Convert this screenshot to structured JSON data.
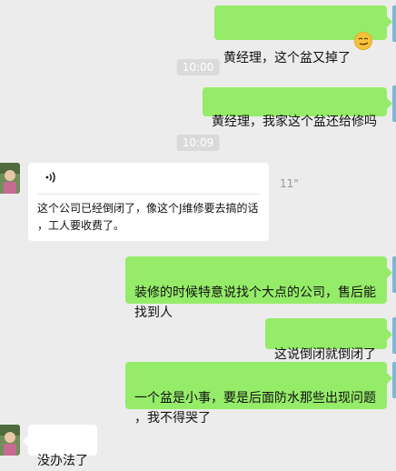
{
  "chat": {
    "messages": [
      {
        "text": "黄经理，这个盆又掉了",
        "emoji": "smirking-face-emoji"
      },
      {
        "text": "黄经理，我家这个盆还给修吗"
      },
      {
        "transcript": "这个公司已经倒闭了，像这个J维修要去搞的话\n，工人要收费了。",
        "duration": "11\""
      },
      {
        "text": "装修的时候特意说找个大点的公司，售后能\n找到人"
      },
      {
        "text": "这说倒闭就倒闭了"
      },
      {
        "text": "一个盆是小事，要是后面防水那些出现问题\n，我不得哭了"
      },
      {
        "text": "没办法了"
      }
    ],
    "timestamps": [
      "10:00",
      "10:09"
    ]
  },
  "colors": {
    "sent_bubble": "#95ec69",
    "received_bubble": "#ffffff",
    "background": "#ececec"
  }
}
